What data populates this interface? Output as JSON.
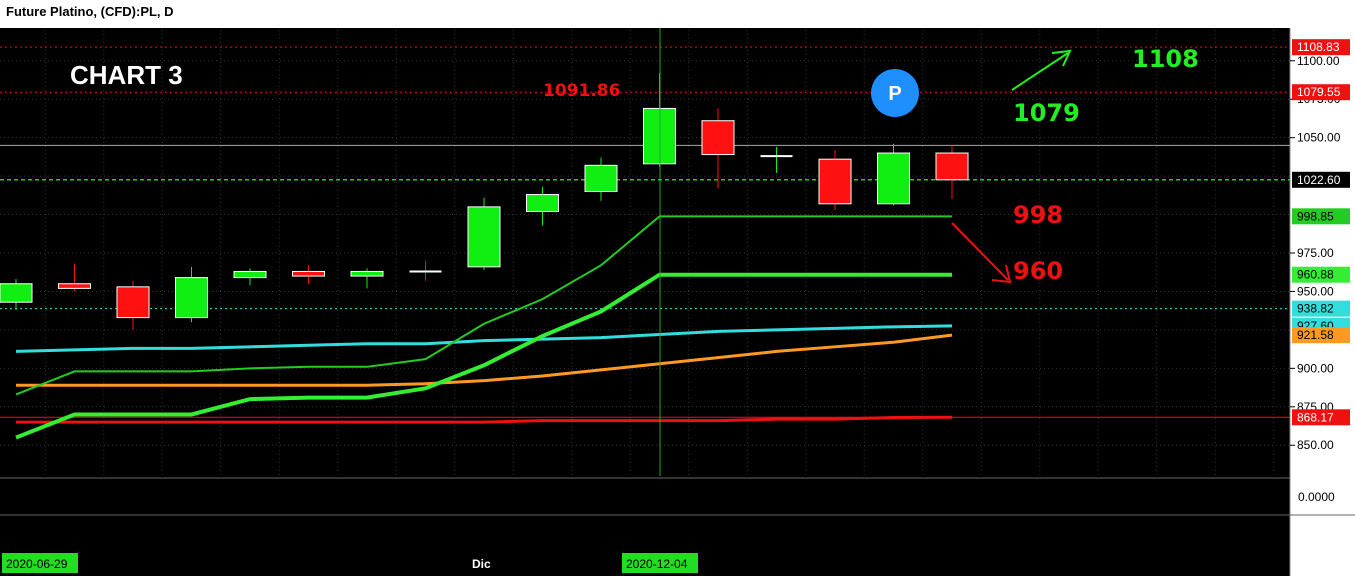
{
  "header": {
    "title": "Future Platino, (CFD):PL, D"
  },
  "chart_data": {
    "type": "candlestick",
    "title": "CHART 3",
    "ylim": [
      830,
      1120
    ],
    "price_ticks": [
      "1100.00",
      "1075.00",
      "1050.00",
      "975.00",
      "950.00",
      "900.00",
      "875.00",
      "850.00"
    ],
    "candles": [
      {
        "o": 943,
        "h": 958,
        "l": 938,
        "c": 955
      },
      {
        "o": 955,
        "h": 968,
        "l": 950,
        "c": 952
      },
      {
        "o": 953,
        "h": 957,
        "l": 925,
        "c": 933
      },
      {
        "o": 933,
        "h": 966,
        "l": 930,
        "c": 959
      },
      {
        "o": 959,
        "h": 965,
        "l": 954,
        "c": 963
      },
      {
        "o": 963,
        "h": 967,
        "l": 955,
        "c": 960
      },
      {
        "o": 960,
        "h": 965,
        "l": 952,
        "c": 963
      },
      {
        "o": 963,
        "h": 970,
        "l": 957,
        "c": 962
      },
      {
        "o": 966,
        "h": 1011,
        "l": 964,
        "c": 1005
      },
      {
        "o": 1002,
        "h": 1018,
        "l": 993,
        "c": 1013
      },
      {
        "o": 1015,
        "h": 1037,
        "l": 1009,
        "c": 1032
      },
      {
        "o": 1033,
        "h": 1091.86,
        "l": 1031,
        "c": 1069
      },
      {
        "o": 1061,
        "h": 1069,
        "l": 1017,
        "c": 1039
      },
      {
        "o": 1038,
        "h": 1044,
        "l": 1027,
        "c": 1038
      },
      {
        "o": 1036,
        "h": 1042,
        "l": 1003,
        "c": 1007
      },
      {
        "o": 1007,
        "h": 1046,
        "l": 1006,
        "c": 1040
      },
      {
        "o": 1040,
        "h": 1045,
        "l": 1010,
        "c": 1022.6
      }
    ],
    "moving_averages": [
      {
        "color": "#33dddd",
        "values": [
          911,
          912,
          913,
          913,
          914,
          915,
          916,
          916,
          918,
          919,
          920,
          922,
          924,
          925,
          926,
          927,
          927.6
        ]
      },
      {
        "color": "#ff9922",
        "values": [
          889,
          889,
          889,
          889,
          889,
          889,
          889,
          890,
          892,
          895,
          899,
          903,
          907,
          911,
          914,
          917,
          921.58
        ]
      },
      {
        "color": "#ee1111",
        "values": [
          865,
          865,
          865,
          865,
          865,
          865,
          865,
          865,
          865,
          866,
          866,
          866,
          866,
          867,
          867,
          868,
          868.17
        ]
      },
      {
        "color": "#22cc22",
        "values": [
          883,
          898,
          898,
          898,
          900,
          901,
          901,
          906,
          929,
          945,
          967,
          998.85,
          998.85,
          998.85,
          998.85,
          998.85,
          998.85
        ]
      },
      {
        "color": "#33ee33",
        "values": [
          855,
          870,
          870,
          870,
          880,
          881,
          881,
          887,
          902,
          921,
          937,
          960.88,
          960.88,
          960.88,
          960.88,
          960.88,
          960.88
        ]
      }
    ],
    "horizontal_lines": [
      {
        "value": 1108.83,
        "color": "#ee1111",
        "style": "dotted"
      },
      {
        "value": 1079.55,
        "color": "#ee1111",
        "style": "dotted"
      },
      {
        "value": 1045,
        "color": "#aaaaaa",
        "style": "solid"
      },
      {
        "value": 1022.6,
        "color": "#22cc22",
        "style": "dashed"
      },
      {
        "value": 938.82,
        "color": "#33dddd",
        "style": "dotted"
      },
      {
        "value": 868.17,
        "color": "#ee1111",
        "style": "solid"
      }
    ],
    "price_labels": [
      {
        "text": "1108.83",
        "value": 1108.83,
        "bg": "#ee1111",
        "fg": "#ffffff"
      },
      {
        "text": "1079.55",
        "value": 1079.55,
        "bg": "#ee1111",
        "fg": "#ffffff"
      },
      {
        "text": "1022.60",
        "value": 1022.6,
        "bg": "#000000",
        "fg": "#ffffff"
      },
      {
        "text": "998.85",
        "value": 998.85,
        "bg": "#22cc22",
        "fg": "#000000"
      },
      {
        "text": "960.88",
        "value": 960.88,
        "bg": "#33ee33",
        "fg": "#000000"
      },
      {
        "text": "938.82",
        "value": 938.82,
        "bg": "#33dddd",
        "fg": "#000000"
      },
      {
        "text": "927.60",
        "value": 927.6,
        "bg": "#33dddd",
        "fg": "#000000"
      },
      {
        "text": "921.58",
        "value": 921.58,
        "bg": "#ff9922",
        "fg": "#000000"
      },
      {
        "text": "868.17",
        "value": 868.17,
        "bg": "#ee1111",
        "fg": "#ffffff"
      }
    ],
    "annotations": {
      "high_label": "1091.86",
      "target_up_1": "1079",
      "target_up_2": "1108",
      "target_down_1": "998",
      "target_down_2": "960",
      "badge": "P"
    },
    "x_labels": [
      "2020-06-29",
      "Dic",
      "2020-12-04"
    ],
    "oscillator_label": "0.0000",
    "colors": {
      "up": "#11ee11",
      "down": "#ff1111",
      "background": "#000000",
      "grid": "#333333"
    }
  }
}
